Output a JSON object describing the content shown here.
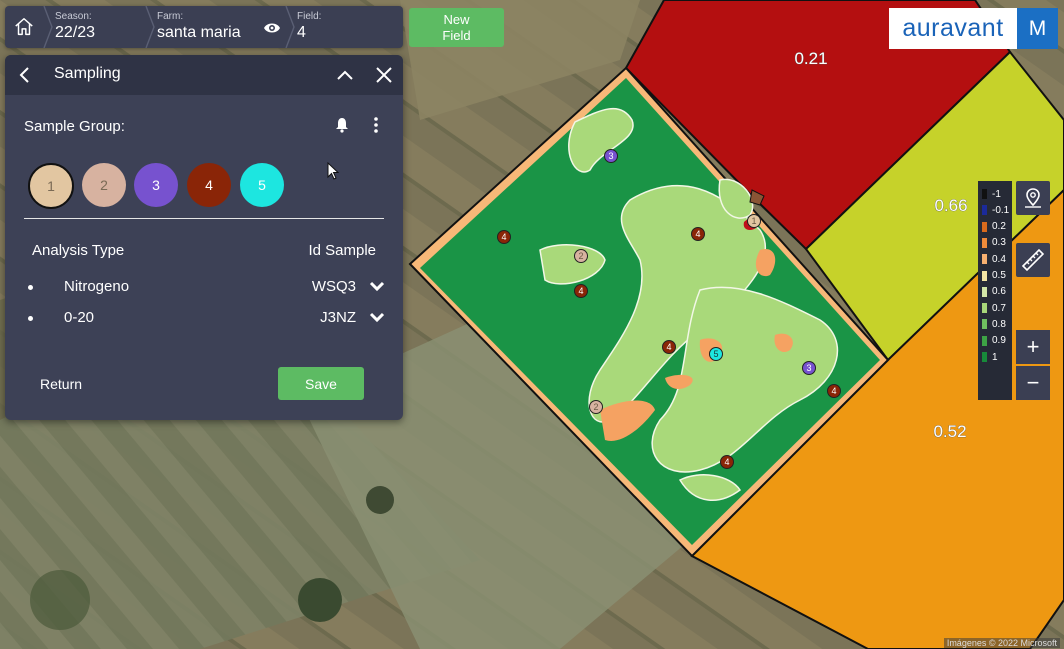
{
  "breadcrumb": {
    "season": {
      "label": "Season:",
      "value": "22/23"
    },
    "farm": {
      "label": "Farm:",
      "value": "santa maria"
    },
    "field": {
      "label": "Field:",
      "value": "4"
    }
  },
  "new_field": {
    "label_line1": "New",
    "label_line2": "Field"
  },
  "logo": {
    "text": "auravant",
    "user_initial": "M"
  },
  "panel": {
    "title": "Sampling",
    "sample_group_label": "Sample Group:",
    "groups": [
      {
        "label": "1",
        "color": "#e2c6a1"
      },
      {
        "label": "2",
        "color": "#d7b2a0"
      },
      {
        "label": "3",
        "color": "#7752cf"
      },
      {
        "label": "4",
        "color": "#8a2507"
      },
      {
        "label": "5",
        "color": "#1de6e0"
      }
    ],
    "col_analysis": "Analysis Type",
    "col_id": "Id Sample",
    "rows": [
      {
        "analysis": "Nitrogeno",
        "id": "WSQ3"
      },
      {
        "analysis": "0-20",
        "id": "J3NZ"
      }
    ],
    "return_label": "Return",
    "save_label": "Save"
  },
  "zones": [
    {
      "value": "0.21",
      "color": "#b30f0f"
    },
    {
      "value": "0.66",
      "color": "#c6d22a"
    },
    {
      "value": "0.52",
      "color": "#ee9812"
    }
  ],
  "legend": [
    {
      "label": "-1",
      "color": "#111111"
    },
    {
      "label": "-0.1",
      "color": "#1b2a9a"
    },
    {
      "label": "0.2",
      "color": "#d96a1c"
    },
    {
      "label": "0.3",
      "color": "#f08b3a"
    },
    {
      "label": "0.4",
      "color": "#f7b070"
    },
    {
      "label": "0.5",
      "color": "#f5e6a5"
    },
    {
      "label": "0.6",
      "color": "#d3e6a8"
    },
    {
      "label": "0.7",
      "color": "#a8d67a"
    },
    {
      "label": "0.8",
      "color": "#6fc060"
    },
    {
      "label": "0.9",
      "color": "#3da345"
    },
    {
      "label": "1",
      "color": "#178a3a"
    }
  ],
  "map_markers": [
    "1",
    "2",
    "3",
    "4",
    "5"
  ],
  "zoom": {
    "in": "+",
    "out": "−"
  },
  "attribution": "Imágenes © 2022 Microsoft"
}
